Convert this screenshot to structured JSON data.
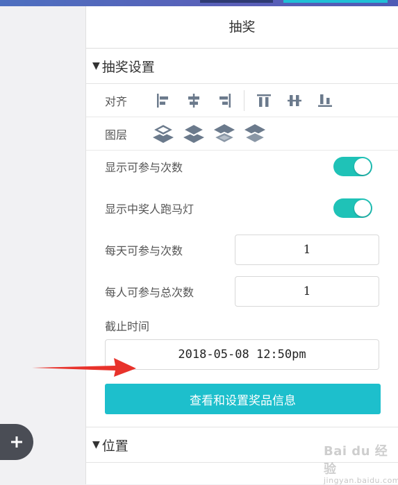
{
  "panel": {
    "title": "抽奖"
  },
  "settings_section": {
    "title": "抽奖设置",
    "align_label": "对齐",
    "layer_label": "图层",
    "align_tools": [
      "align-left-icon",
      "align-center-h-icon",
      "align-right-icon",
      "align-top-icon",
      "align-middle-v-icon",
      "align-bottom-icon"
    ],
    "layer_tools": [
      "layer-bring-front-icon",
      "layer-bring-forward-icon",
      "layer-send-backward-icon",
      "layer-send-back-icon"
    ],
    "show_count": {
      "label": "显示可参与次数",
      "on": true
    },
    "show_marquee": {
      "label": "显示中奖人跑马灯",
      "on": true
    },
    "daily_count": {
      "label": "每天可参与次数",
      "value": "1"
    },
    "total_count": {
      "label": "每人可参与总次数",
      "value": "1"
    },
    "deadline": {
      "label": "截止时间",
      "value": "2018-05-08 12:50pm"
    },
    "prize_button": "查看和设置奖品信息"
  },
  "position_section": {
    "title": "位置"
  },
  "colors": {
    "accent": "#1fc2b7",
    "button": "#1dbfcc",
    "arrow": "#e8322b"
  },
  "watermark": {
    "brand": "Bai du 经验",
    "sub": "jingyan.baidu.com"
  }
}
